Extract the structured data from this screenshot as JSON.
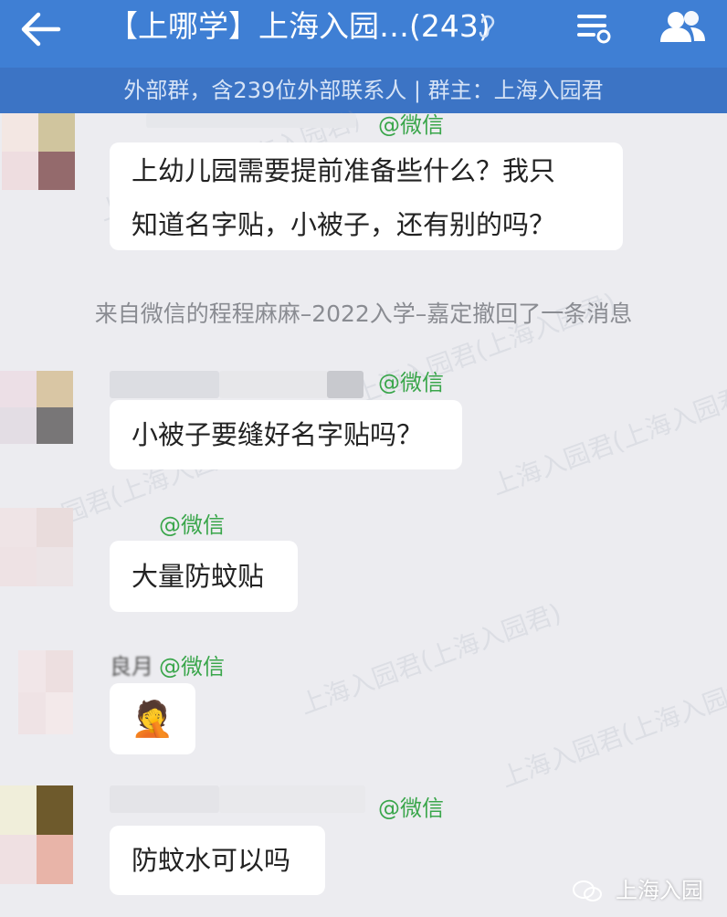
{
  "header": {
    "title": "【上哪学】上海入园…(243)",
    "subtitle": "外部群，含239位外部联系人 | 群主：上海入园君"
  },
  "icons": {
    "back": "back-arrow-icon",
    "ear": "earpiece-icon",
    "menu": "chat-settings-icon",
    "people": "group-members-icon"
  },
  "watermark": "上海入园君(上海入园君)",
  "messages": [
    {
      "sender_tag": "@微信",
      "text_lines": [
        "上幼儿园需要提前准备些什么？我只",
        "知道名字贴，小被子，还有别的吗？"
      ]
    },
    {
      "sender_tag": "@微信",
      "text_lines": [
        "小被子要缝好名字贴吗？"
      ]
    },
    {
      "sender_tag": "@微信",
      "text_lines": [
        "大量防蚊贴"
      ]
    },
    {
      "sender_tag": "@微信",
      "name_fragment": "良月",
      "emoji": "🤦"
    },
    {
      "sender_tag": "@微信",
      "text_lines": [
        "防蚊水可以吗"
      ]
    }
  ],
  "system_message": "来自微信的程程麻麻–2022入学–嘉定撤回了一条消息",
  "footer": {
    "label": "上海入园"
  },
  "colors": {
    "header": "#3f7fd4",
    "subheader": "#3c74c5",
    "wechat_tag": "#3aa64b",
    "background": "#ececf0"
  }
}
